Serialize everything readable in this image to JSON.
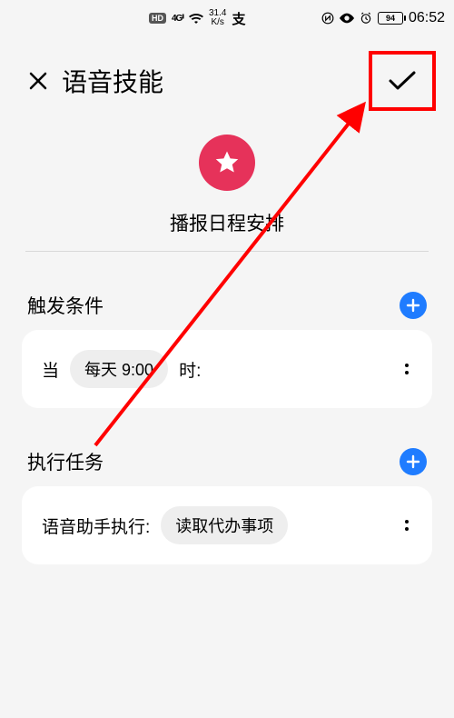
{
  "statusbar": {
    "hd": "HD",
    "net_gen": "4G",
    "speed_top": "31.4",
    "speed_bottom": "K/s",
    "alipay": "支",
    "battery": "94",
    "time": "06:52"
  },
  "header": {
    "title": "语音技能"
  },
  "skill": {
    "name": "播报日程安排"
  },
  "trigger": {
    "section_title": "触发条件",
    "prefix": "当",
    "chip": "每天 9:00",
    "suffix": "时:"
  },
  "task": {
    "section_title": "执行任务",
    "label": "语音助手执行:",
    "chip": "读取代办事项"
  }
}
